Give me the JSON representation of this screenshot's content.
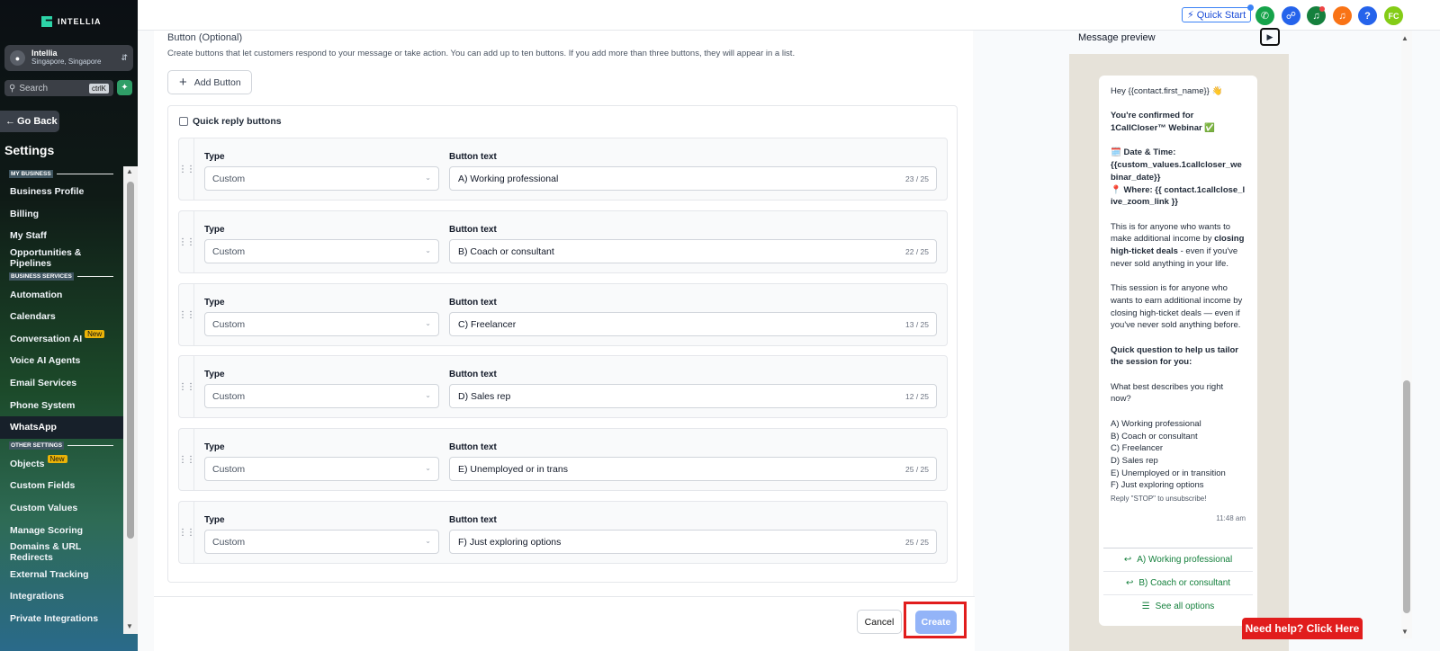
{
  "brand": {
    "name": "INTELLIA"
  },
  "account": {
    "name": "Intellia",
    "location": "Singapore, Singapore"
  },
  "search": {
    "placeholder": "Search",
    "shortcut": "ctrlK"
  },
  "nav": {
    "go_back": "Go Back",
    "title": "Settings",
    "sections": {
      "my_business": "MY BUSINESS",
      "business_services": "BUSINESS SERVICES",
      "other_settings": "OTHER SETTINGS"
    },
    "items": {
      "business_profile": "Business Profile",
      "billing": "Billing",
      "my_staff": "My Staff",
      "opportunities": "Opportunities & Pipelines",
      "automation": "Automation",
      "calendars": "Calendars",
      "conversation_ai": "Conversation AI",
      "voice_ai": "Voice AI Agents",
      "email_services": "Email Services",
      "phone_system": "Phone System",
      "whatsapp": "WhatsApp",
      "objects": "Objects",
      "custom_fields": "Custom Fields",
      "custom_values": "Custom Values",
      "manage_scoring": "Manage Scoring",
      "domains": "Domains & URL Redirects",
      "external_tracking": "External Tracking",
      "integrations": "Integrations",
      "private_integrations": "Private Integrations"
    },
    "new_badge": "New"
  },
  "topbar": {
    "quick_start": "Quick Start",
    "avatar_initials": "FC",
    "colors": {
      "phone": "#16a34a",
      "link": "#2563eb",
      "megaphone": "#15803d",
      "bell": "#f97316",
      "help": "#2563eb",
      "avatar": "#84cc16"
    }
  },
  "form": {
    "section_title": "Button (Optional)",
    "section_desc": "Create buttons that let customers respond to your message or take action. You can add up to ten buttons. If you add more than three buttons, they will appear in a list.",
    "add_button": "Add Button",
    "quick_reply_title": "Quick reply buttons",
    "type_label": "Type",
    "text_label": "Button text",
    "rows": [
      {
        "type": "Custom",
        "text": "A) Working professional",
        "count": "23 / 25"
      },
      {
        "type": "Custom",
        "text": "B) Coach or consultant",
        "count": "22 / 25"
      },
      {
        "type": "Custom",
        "text": "C) Freelancer",
        "count": "13 / 25"
      },
      {
        "type": "Custom",
        "text": "D) Sales rep",
        "count": "12 / 25"
      },
      {
        "type": "Custom",
        "text": "E) Unemployed or in trans",
        "count": "25 / 25"
      },
      {
        "type": "Custom",
        "text": "F) Just exploring options",
        "count": "25 / 25"
      }
    ],
    "cancel": "Cancel",
    "create": "Create"
  },
  "preview": {
    "title": "Message preview",
    "greeting": "Hey {{contact.first_name}} 👋",
    "confirmed": "You're confirmed for 1CallCloser™ Webinar ✅",
    "datetime_label": "🗓️ Date & Time:",
    "datetime_value": "{{custom_values.1callcloser_webinar_date}}",
    "where": "📍 Where: {{ contact.1callclose_live_zoom_link }}",
    "para1_a": "This is for anyone who wants to make additional income by ",
    "para1_b": "closing high-ticket deals",
    "para1_c": " - even if you've never sold anything in your life.",
    "para2": "This session is for anyone who wants to earn additional income by closing high-ticket deals — even if you've never sold anything before.",
    "question": "Quick question to help us tailor the session for you:",
    "ask": "What best describes you right now?",
    "options": [
      "A) Working professional",
      "B) Coach or consultant",
      "C) Freelancer",
      "D) Sales rep",
      "E) Unemployed or in transition",
      "F) Just exploring options"
    ],
    "unsubscribe": "Reply \"STOP\" to unsubscribe!",
    "time": "11:48 am",
    "btn1": "A) Working professional",
    "btn2": "B) Coach or consultant",
    "see_all": "See all options"
  },
  "help": {
    "label": "Need help? Click Here"
  }
}
